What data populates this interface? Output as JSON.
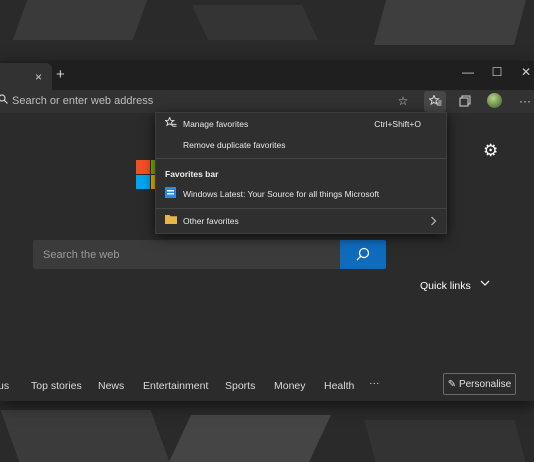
{
  "browser": {
    "tab_close": "×",
    "new_tab": "+",
    "window_controls": {
      "minimize": "—",
      "maximize": "☐",
      "close": "✕"
    },
    "address_placeholder": "Search or enter web address",
    "toolbar": {
      "star": "☆",
      "more": "···"
    }
  },
  "favorites_menu": {
    "manage_label": "Manage favorites",
    "manage_shortcut": "Ctrl+Shift+O",
    "remove_duplicates_label": "Remove duplicate favorites",
    "bar_heading": "Favorites bar",
    "bar_item_label": "Windows Latest: Your Source for all things Microsoft",
    "other_label": "Other favorites"
  },
  "newtab": {
    "search_placeholder": "Search the web",
    "quick_links_label": "Quick links",
    "news_items": [
      "us",
      "Top stories",
      "News",
      "Entertainment",
      "Sports",
      "Money",
      "Health",
      "···"
    ],
    "personalise_label": "Personalise"
  },
  "colors": {
    "accent": "#0f6cbd",
    "ms_red": "#f25022",
    "ms_green": "#7fba00",
    "ms_blue": "#00a4ef",
    "ms_yellow": "#ffb900",
    "folder": "#e8b54a"
  },
  "icons": [
    "favorites-icon",
    "collections-icon",
    "gear-icon",
    "search-icon",
    "folder-icon",
    "chevron-right-icon",
    "pencil-icon"
  ]
}
